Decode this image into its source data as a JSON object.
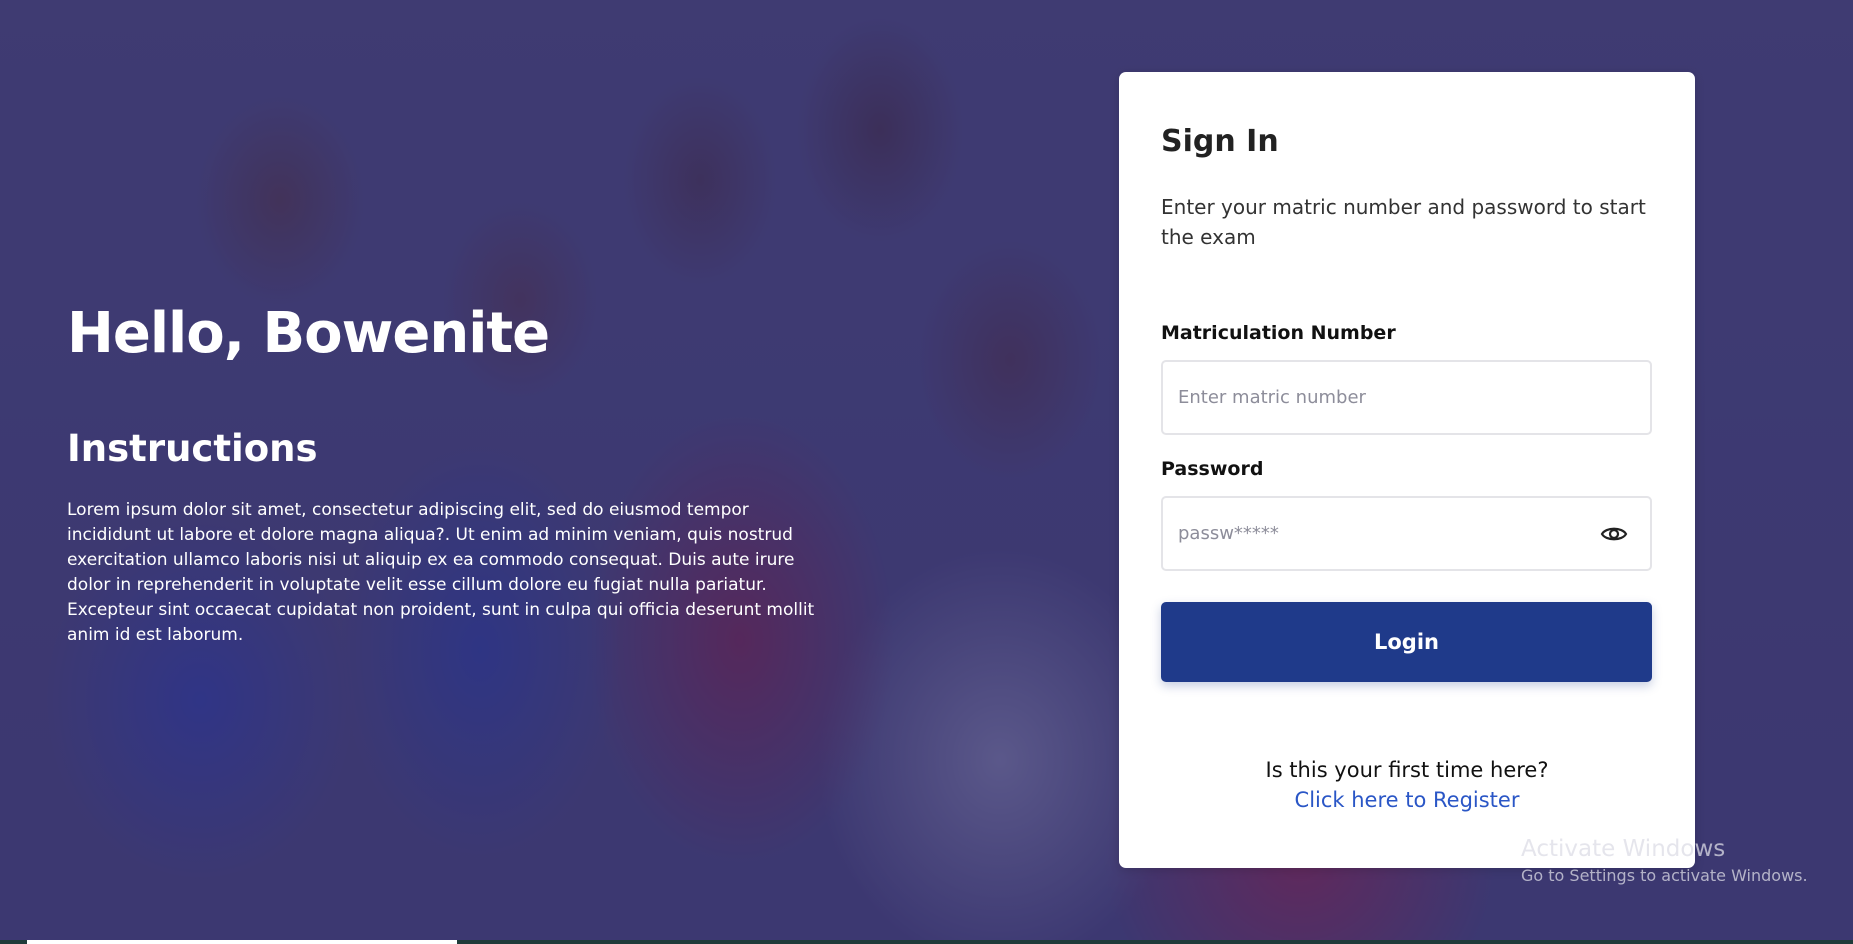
{
  "hero": {
    "greeting": "Hello, Bowenite",
    "instructions_title": "Instructions",
    "instructions_text": "Lorem ipsum dolor sit amet, consectetur adipiscing elit, sed do eiusmod tempor incididunt ut labore et dolore magna aliqua?. Ut enim ad minim veniam, quis nostrud exercitation ullamco laboris nisi ut aliquip ex ea commodo consequat. Duis aute irure dolor in reprehenderit in voluptate velit esse cillum dolore eu fugiat nulla pariatur. Excepteur sint occaecat cupidatat non proident, sunt in culpa qui officia deserunt mollit anim id est laborum."
  },
  "signin": {
    "title": "Sign In",
    "subtitle": "Enter your matric number and password to start the exam",
    "matric_label": "Matriculation Number",
    "matric_placeholder": "Enter matric number",
    "matric_value": "",
    "password_label": "Password",
    "password_placeholder": "passw*****",
    "password_value": "",
    "password_toggle_icon": "eye-icon",
    "login_label": "Login",
    "first_time_text": "Is this your first time here?",
    "register_link": "Click here to Register"
  },
  "watermark": {
    "line1": "Activate Windows",
    "line2": "Go to Settings to activate Windows."
  },
  "colors": {
    "overlay": "#342f6e",
    "primary_button": "#1f3a8a",
    "link": "#2a56c6",
    "card_bg": "#ffffff"
  }
}
